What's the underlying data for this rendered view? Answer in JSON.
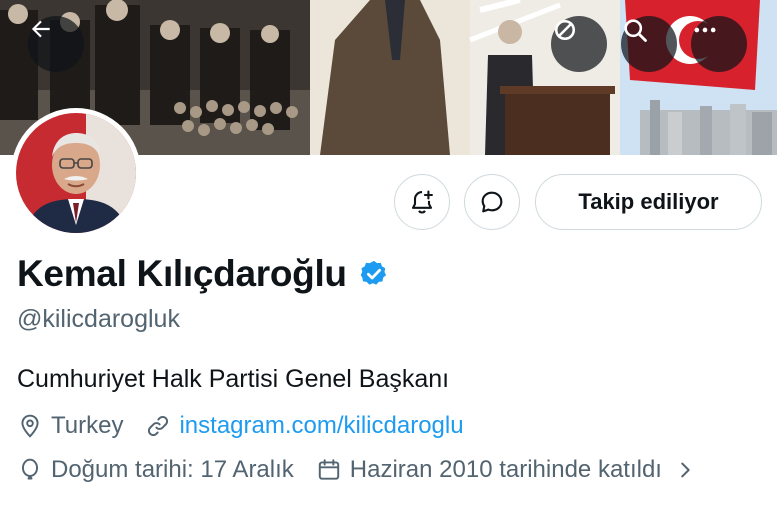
{
  "header": {
    "back_icon": "arrow-left-icon",
    "no_sub_icon": "circle-slash-icon",
    "search_icon": "search-icon",
    "more_icon": "more-horizontal-icon"
  },
  "profile": {
    "display_name": "Kemal Kılıçdaroğlu",
    "verified": true,
    "handle": "@kilicdarogluk",
    "bio": "Cumhuriyet Halk Partisi Genel Başkanı",
    "location": "Turkey",
    "website": "instagram.com/kilicdaroglu",
    "birthday": "Doğum tarihi: 17 Aralık",
    "joined": "Haziran 2010 tarihinde katıldı"
  },
  "actions": {
    "follow_label": "Takip ediliyor",
    "notify_icon": "bell-plus-icon",
    "message_icon": "message-bubble-icon"
  },
  "colors": {
    "accent": "#1d9bf0",
    "secondary_text": "#536471",
    "primary_text": "#0f1419",
    "border": "#cfd9de"
  }
}
